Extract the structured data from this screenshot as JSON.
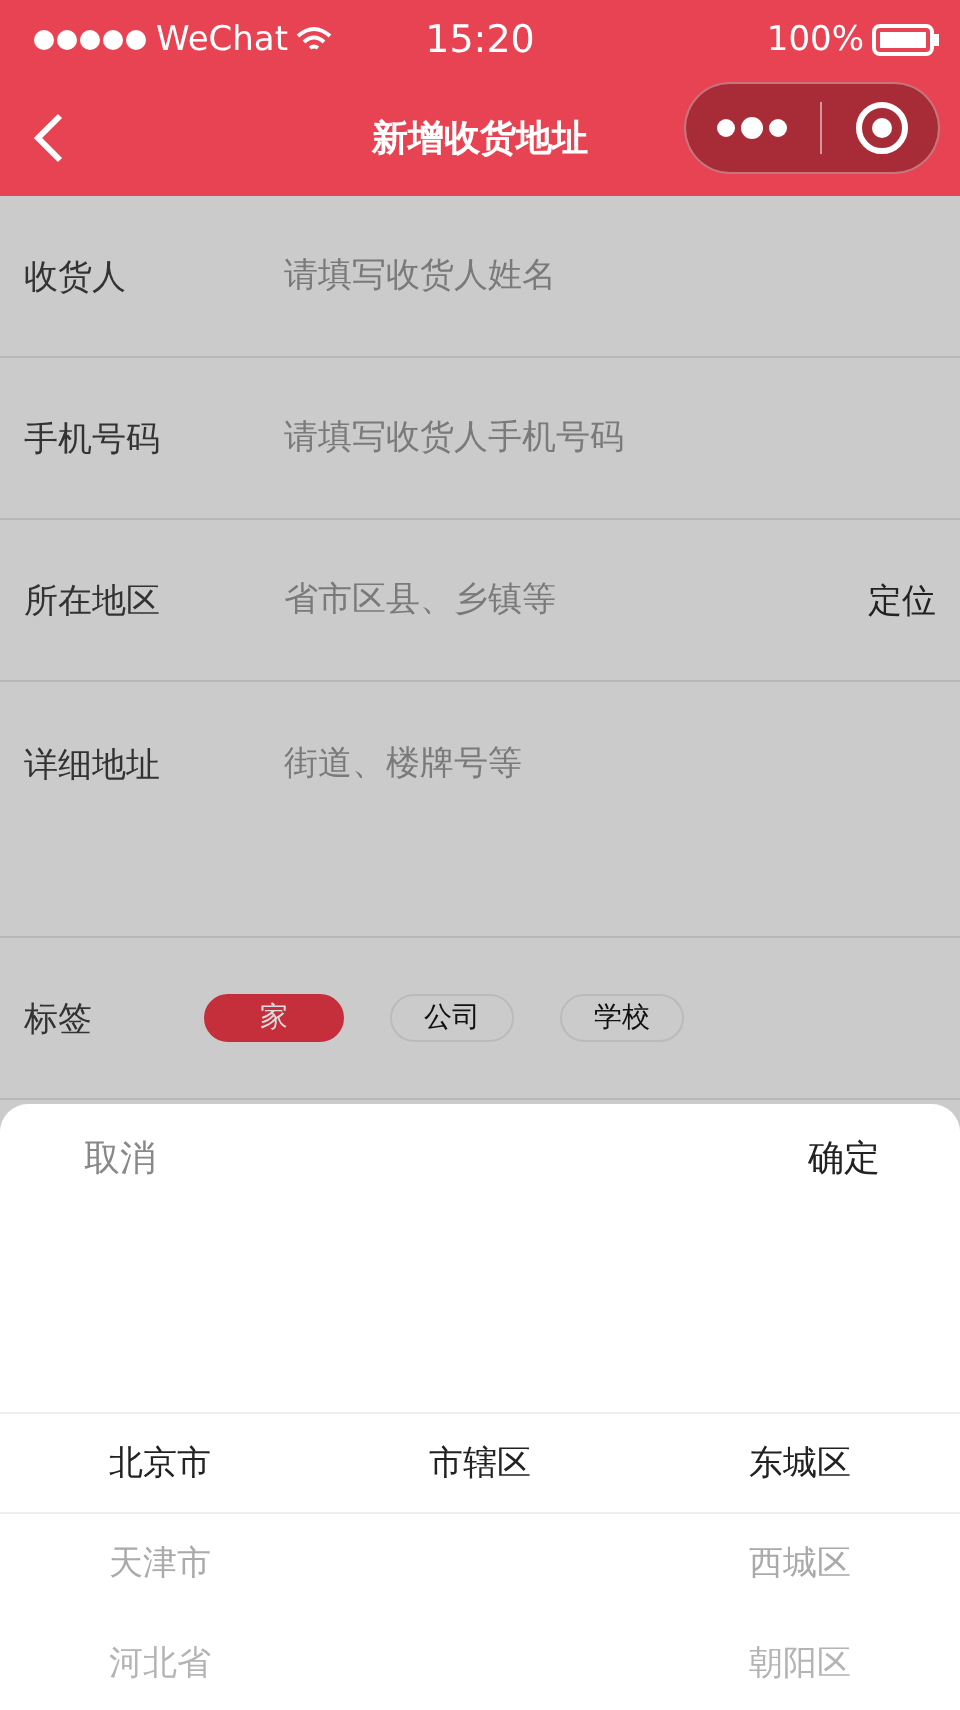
{
  "status_bar": {
    "carrier": "WeChat",
    "time": "15:20",
    "battery": "100%"
  },
  "nav": {
    "title": "新增收货地址"
  },
  "form": [
    {
      "kind": "input",
      "label": "收货人",
      "placeholder": "请填写收货人姓名"
    },
    {
      "kind": "input",
      "label": "手机号码",
      "placeholder": "请填写收货人手机号码"
    },
    {
      "kind": "input",
      "label": "所在地区",
      "placeholder": "省市区县、乡镇等",
      "action": "定位"
    },
    {
      "kind": "textarea",
      "label": "详细地址",
      "placeholder": "街道、楼牌号等"
    }
  ],
  "tags": {
    "label": "标签",
    "items": [
      {
        "label": "家",
        "selected": true
      },
      {
        "label": "公司",
        "selected": false
      },
      {
        "label": "学校",
        "selected": false
      }
    ]
  },
  "picker": {
    "cancel": "取消",
    "confirm": "确定",
    "columns": [
      {
        "options": [
          {
            "label": "北京市",
            "selected": true
          },
          {
            "label": "天津市",
            "selected": false
          },
          {
            "label": "河北省",
            "selected": false
          }
        ]
      },
      {
        "options": [
          {
            "label": "市辖区",
            "selected": true
          }
        ]
      },
      {
        "options": [
          {
            "label": "东城区",
            "selected": true
          },
          {
            "label": "西城区",
            "selected": false
          },
          {
            "label": "朝阳区",
            "selected": false
          }
        ]
      }
    ]
  }
}
